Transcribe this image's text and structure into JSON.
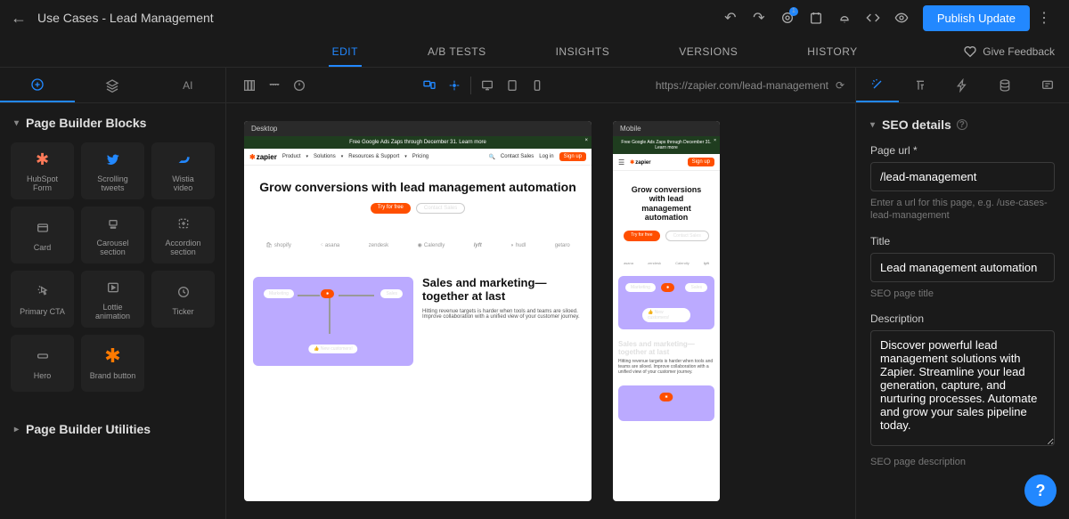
{
  "header": {
    "page_title": "Use Cases - Lead Management",
    "publish_label": "Publish Update"
  },
  "tabs": {
    "items": [
      "EDIT",
      "A/B TESTS",
      "INSIGHTS",
      "VERSIONS",
      "HISTORY"
    ],
    "feedback": "Give Feedback"
  },
  "left_panel": {
    "tab_ai": "AI",
    "section_blocks": "Page Builder Blocks",
    "section_utilities": "Page Builder Utilities",
    "blocks": [
      {
        "label": "HubSpot\nForm",
        "icon": "hubspot"
      },
      {
        "label": "Scrolling\ntweets",
        "icon": "twitter"
      },
      {
        "label": "Wistia\nvideo",
        "icon": "wistia"
      },
      {
        "label": "Card",
        "icon": "card"
      },
      {
        "label": "Carousel\nsection",
        "icon": "carousel"
      },
      {
        "label": "Accordion\nsection",
        "icon": "accordion"
      },
      {
        "label": "Primary CTA",
        "icon": "cta"
      },
      {
        "label": "Lottie\nanimation",
        "icon": "lottie"
      },
      {
        "label": "Ticker",
        "icon": "ticker"
      },
      {
        "label": "Hero",
        "icon": "hero"
      },
      {
        "label": "Brand button",
        "icon": "brand"
      }
    ]
  },
  "canvas": {
    "url": "https://zapier.com/lead-management",
    "desktop_label": "Desktop",
    "mobile_label": "Mobile",
    "promo": "Free Google Ads Zaps through December 31. Learn more",
    "nav": {
      "logo": "zapier",
      "items": [
        "Product",
        "Solutions",
        "Resources & Support",
        "Pricing"
      ],
      "contact": "Contact Sales",
      "login": "Log in",
      "signup": "Sign up"
    },
    "hero": {
      "headline": "Grow conversions with lead management automation",
      "btn_primary": "Try for free",
      "btn_secondary": "Contact Sales"
    },
    "logos": [
      "shopify",
      "asana",
      "zendesk",
      "Calendly",
      "lyft",
      "hudl",
      "getaro"
    ],
    "section2": {
      "headline": "Sales and marketing—together at last",
      "body": "Hitting revenue targets is harder when tools and teams are siloed. Improve collaboration with a unified view of your customer journey.",
      "node1": "Marketing",
      "node2": "Sales",
      "node3": "New customers!"
    }
  },
  "right_panel": {
    "seo_header": "SEO details",
    "page_url_label": "Page url *",
    "page_url_value": "/lead-management",
    "page_url_hint": "Enter a url for this page, e.g. /use-cases-lead-management",
    "title_label": "Title",
    "title_value": "Lead management automation",
    "title_hint": "SEO page title",
    "desc_label": "Description",
    "desc_value": "Discover powerful lead management solutions with Zapier. Streamline your lead generation, capture, and nurturing processes. Automate and grow your sales pipeline today.",
    "desc_hint": "SEO page description"
  }
}
